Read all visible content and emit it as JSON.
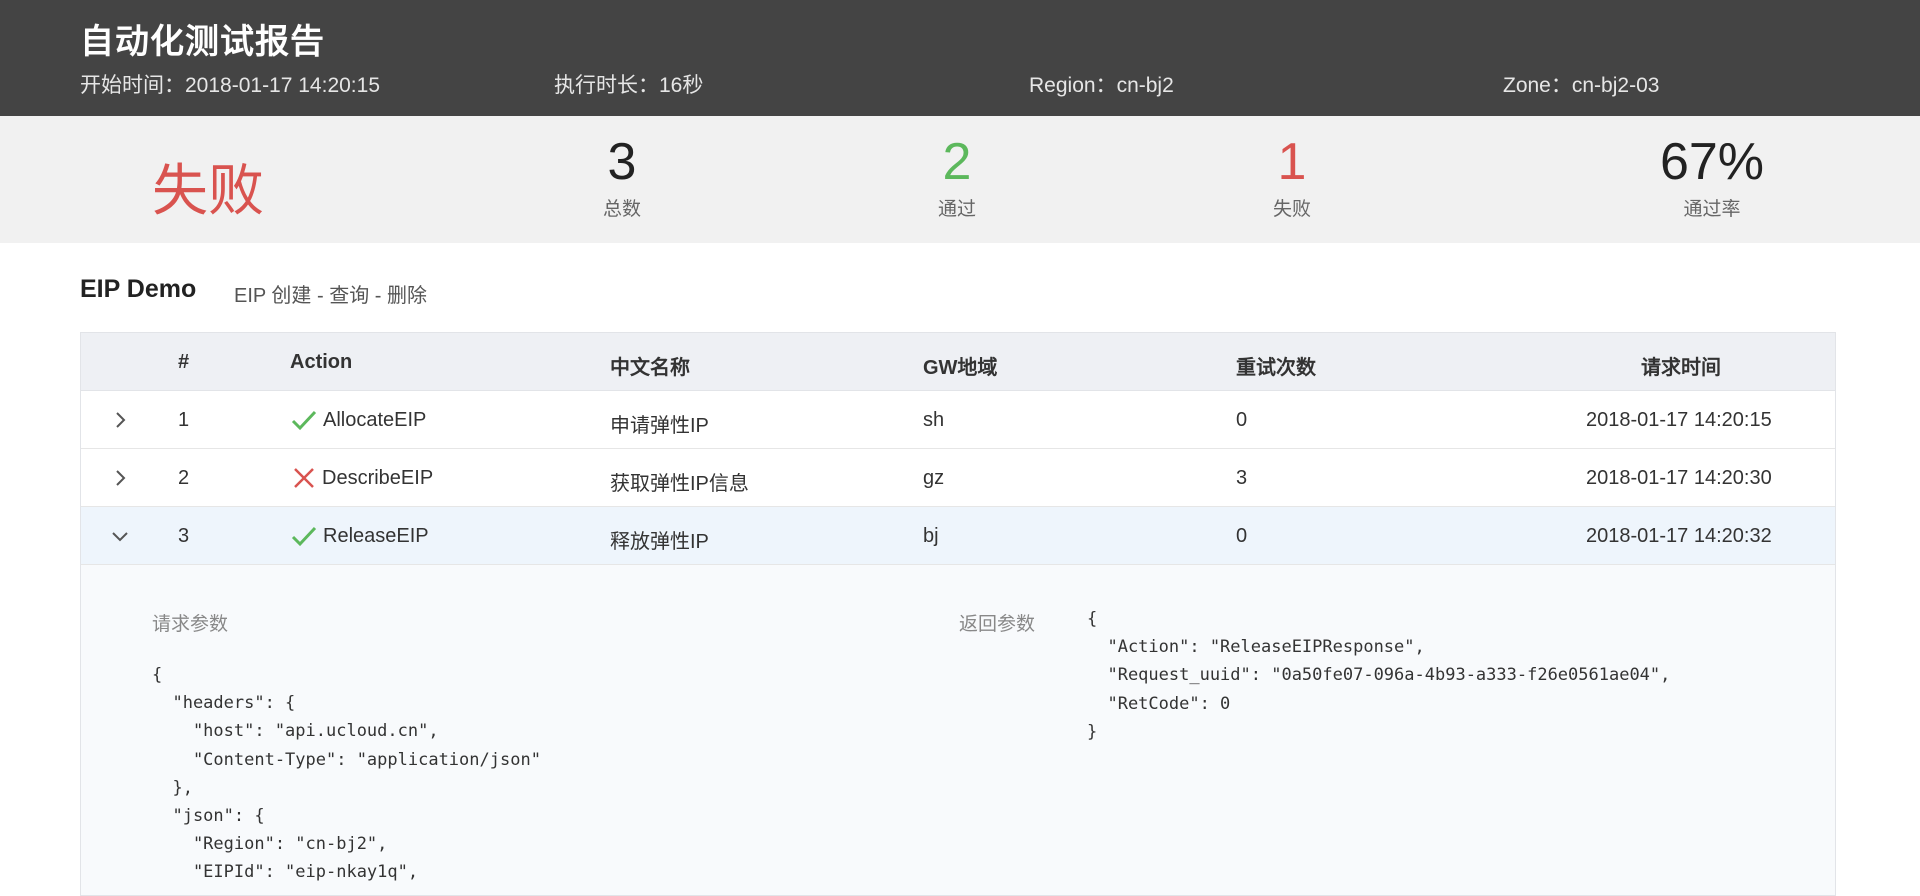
{
  "header": {
    "title": "自动化测试报告",
    "meta": [
      {
        "key": "开始时间：",
        "value": "2018-01-17 14:20:15"
      },
      {
        "key": "执行时长：",
        "value": "16秒"
      },
      {
        "key": "Region：",
        "value": "cn-bj2"
      },
      {
        "key": "Zone：",
        "value": "cn-bj2-03"
      }
    ]
  },
  "summary": {
    "status": "失败",
    "total": {
      "value": "3",
      "label": "总数"
    },
    "passed": {
      "value": "2",
      "label": "通过"
    },
    "failed": {
      "value": "1",
      "label": "失败"
    },
    "pass_rate": {
      "value": "67%",
      "label": "通过率"
    }
  },
  "suite": {
    "name": "EIP Demo",
    "description": "EIP 创建 - 查询 - 删除"
  },
  "table": {
    "columns": [
      "#",
      "Action",
      "中文名称",
      "GW地域",
      "重试次数",
      "请求时间"
    ],
    "rows": [
      {
        "index": "1",
        "status": "pass",
        "action": "AllocateEIP",
        "name": "申请弹性IP",
        "region": "sh",
        "retries": "0",
        "time": "2018-01-17 14:20:15",
        "expanded": false
      },
      {
        "index": "2",
        "status": "fail",
        "action": "DescribeEIP",
        "name": "获取弹性IP信息",
        "region": "gz",
        "retries": "3",
        "time": "2018-01-17 14:20:30",
        "expanded": false
      },
      {
        "index": "3",
        "status": "pass",
        "action": "ReleaseEIP",
        "name": "释放弹性IP",
        "region": "bj",
        "retries": "0",
        "time": "2018-01-17 14:20:32",
        "expanded": true
      }
    ]
  },
  "detail": {
    "request_label": "请求参数",
    "response_label": "返回参数",
    "request_body": "{\n  \"headers\": {\n    \"host\": \"api.ucloud.cn\",\n    \"Content-Type\": \"application/json\"\n  },\n  \"json\": {\n    \"Region\": \"cn-bj2\",\n    \"EIPId\": \"eip-nkay1q\",",
    "response_body": "{\n  \"Action\": \"ReleaseEIPResponse\",\n  \"Request_uuid\": \"0a50fe07-096a-4b93-a333-f26e0561ae04\",\n  \"RetCode\": 0\n}"
  },
  "colors": {
    "header_bg": "#444444",
    "pass": "#5cb85c",
    "fail": "#d9534f"
  },
  "icons": {
    "collapsed": "chevron-right-icon",
    "expanded": "chevron-down-icon",
    "pass": "check-icon",
    "fail": "cross-icon"
  }
}
